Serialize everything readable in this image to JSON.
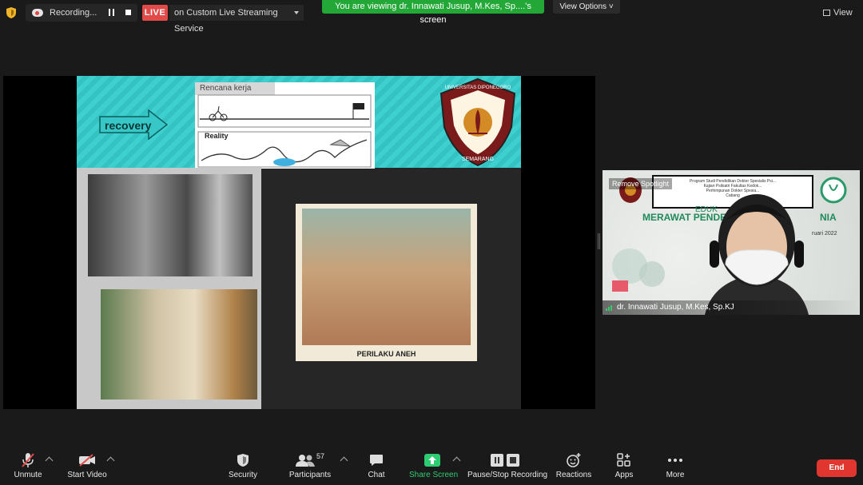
{
  "topbar": {
    "recording_text": "Recording...",
    "live_badge": "LIVE",
    "live_service": "on Custom Live Streaming Service",
    "viewing_banner": "You are viewing dr. Innawati Jusup, M.Kes, Sp....'s screen",
    "view_options": "View Options",
    "view_label": "View"
  },
  "slide": {
    "recovery_label": "recovery",
    "plan_title": "Rencana kerja",
    "reality_label": "Reality",
    "logo_top_text": "UNIVERSITAS DIPONEGORO",
    "logo_bottom_text": "SEMARANG",
    "cartoon_caption": "PERILAKU ANEH"
  },
  "speaker": {
    "remove_spotlight": "Remove Spotlight",
    "poster_line1": "Program Studi Pendidikan Dokter Spesialis Psi...",
    "poster_line2": "Kajian Psikiatri Fakultas Kedok...",
    "poster_line3": "Perhimpunan Dokter Spesia...",
    "poster_line4": "Cabang",
    "poster_edu": "EDUK",
    "poster_title": "MERAWAT PENDE",
    "poster_title_end": "NIA",
    "poster_date": "ruari 2022",
    "name": "dr. Innawati Jusup, M.Kes, Sp.KJ"
  },
  "toolbar": {
    "unmute": "Unmute",
    "start_video": "Start Video",
    "security": "Security",
    "participants": "Participants",
    "participants_count": "57",
    "chat": "Chat",
    "share_screen": "Share Screen",
    "pause_recording": "Pause/Stop Recording",
    "reactions": "Reactions",
    "apps": "Apps",
    "more": "More",
    "end": "End"
  },
  "colors": {
    "live_red": "#e24a4a",
    "banner_green": "#23a838",
    "end_red": "#e0362f",
    "slide_teal": "#3ecfcf"
  }
}
